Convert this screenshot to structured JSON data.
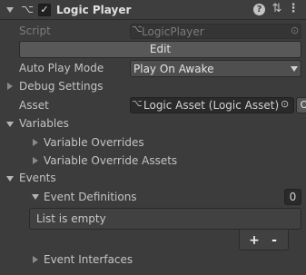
{
  "header": {
    "component_title": "Logic Player",
    "enabled": true,
    "help_icon": "help-icon",
    "presets_icon": "presets-icon",
    "menu_icon": "kebab-menu-icon",
    "script_icon": "script-icon"
  },
  "script": {
    "label": "Script",
    "value": "LogicPlayer"
  },
  "edit_button": {
    "label": "Edit"
  },
  "auto_play": {
    "label": "Auto Play Mode",
    "value": "Play On Awake"
  },
  "debug_settings": {
    "label": "Debug Settings"
  },
  "asset": {
    "label": "Asset",
    "value": "Logic Asset (Logic Asset)"
  },
  "variables": {
    "label": "Variables",
    "overrides_label": "Variable Overrides",
    "override_assets_label": "Variable Override Assets"
  },
  "events": {
    "label": "Events",
    "definitions_label": "Event Definitions",
    "definitions_count": "0",
    "empty_text": "List is empty",
    "add_label": "+",
    "remove_label": "-",
    "interfaces_label": "Event Interfaces"
  },
  "colors": {
    "background": "#3c3c3c",
    "field": "#2a2a2a",
    "text": "#c4c4c4"
  }
}
